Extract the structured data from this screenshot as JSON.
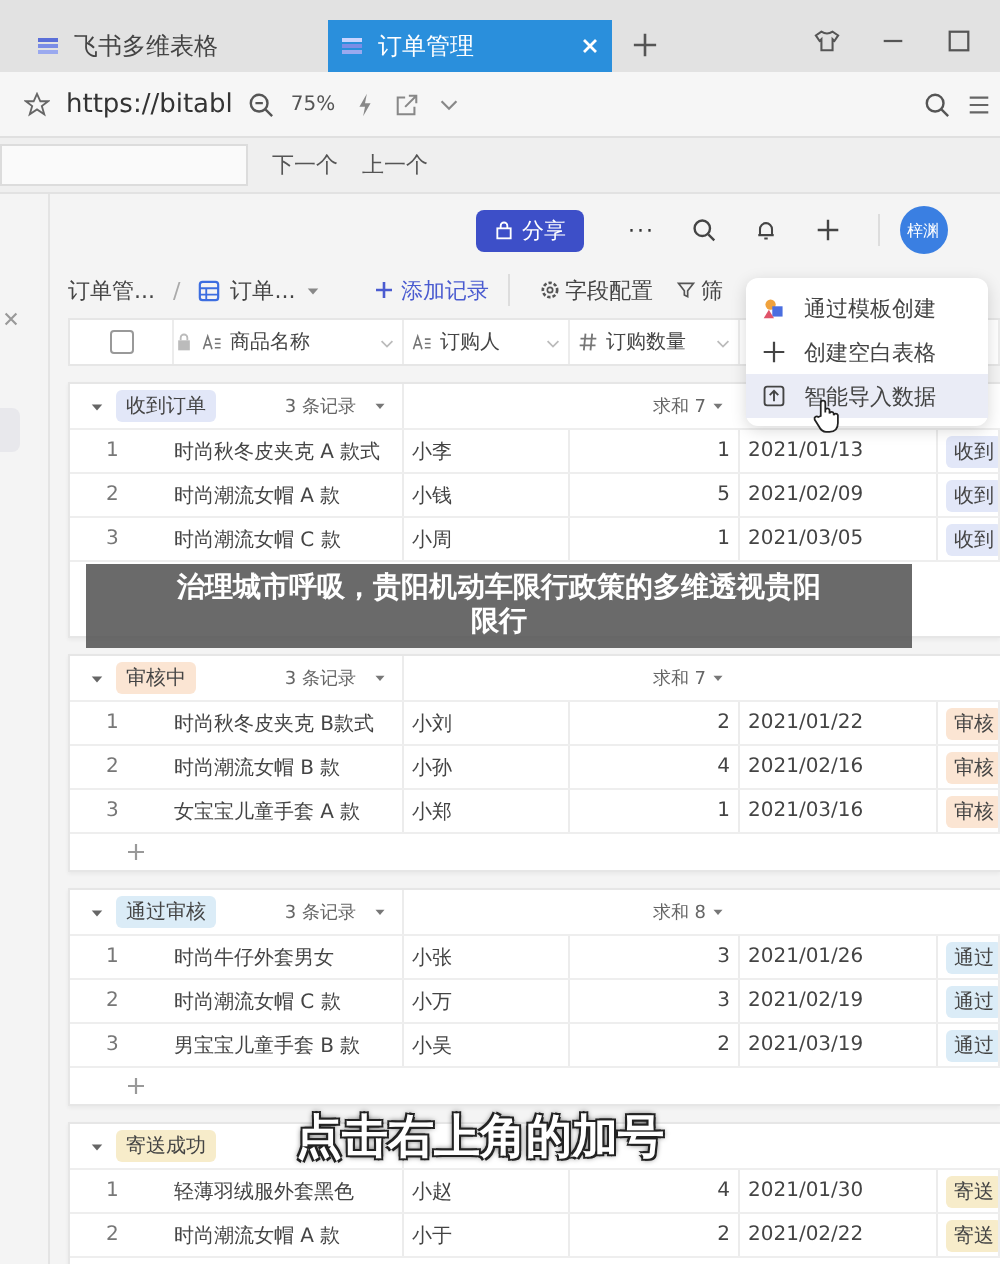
{
  "browser": {
    "tabs": [
      {
        "title": "飞书多维表格",
        "selected": false
      },
      {
        "title": "订单管理",
        "selected": true
      }
    ],
    "url": "https://bitabl",
    "zoom": "75%"
  },
  "find_bar": {
    "next": "下一个",
    "previous": "上一个"
  },
  "header": {
    "share": "分享",
    "more": "···",
    "avatar": "梓渊"
  },
  "toolbar": {
    "breadcrumb": [
      "订单管...",
      "订单..."
    ],
    "separator": "/",
    "add_record": "添加记录",
    "field_config": "字段配置",
    "filter": "筛"
  },
  "menu": [
    {
      "label": "通过模板创建",
      "kind": "template",
      "selected": false
    },
    {
      "label": "创建空白表格",
      "kind": "blank",
      "selected": false
    },
    {
      "label": "智能导入数据",
      "kind": "import",
      "selected": true
    }
  ],
  "table": {
    "select_all_checked": false,
    "columns": [
      {
        "label": "商品名称",
        "kind": "text"
      },
      {
        "label": "订购人",
        "kind": "text"
      },
      {
        "label": "订购数量",
        "kind": "number"
      }
    ],
    "groups": [
      {
        "name": "收到订单",
        "color": "#e2e7f8",
        "count": "3 条记录",
        "sum": "求和 7",
        "rows": [
          {
            "num": "1",
            "name": "时尚秋冬皮夹克 A 款式",
            "buyer": "小李",
            "qty": "1",
            "date": "2021/01/13",
            "status": "收到"
          },
          {
            "num": "2",
            "name": "时尚潮流女帽 A 款",
            "buyer": "小钱",
            "qty": "5",
            "date": "2021/02/09",
            "status": "收到"
          },
          {
            "num": "3",
            "name": "时尚潮流女帽 C 款",
            "buyer": "小周",
            "qty": "1",
            "date": "2021/03/05",
            "status": "收到"
          }
        ]
      },
      {
        "name": "审核中",
        "color": "#fbe5d3",
        "count": "3 条记录",
        "sum": "求和 7",
        "show_add": true,
        "rows": [
          {
            "num": "1",
            "name": "时尚秋冬皮夹克 B款式",
            "buyer": "小刘",
            "qty": "2",
            "date": "2021/01/22",
            "status": "审核"
          },
          {
            "num": "2",
            "name": "时尚潮流女帽 B 款",
            "buyer": "小孙",
            "qty": "4",
            "date": "2021/02/16",
            "status": "审核"
          },
          {
            "num": "3",
            "name": "女宝宝儿童手套 A 款",
            "buyer": "小郑",
            "qty": "1",
            "date": "2021/03/16",
            "status": "审核"
          }
        ]
      },
      {
        "name": "通过审核",
        "color": "#dbecf7",
        "count": "3 条记录",
        "sum": "求和 8",
        "show_add": true,
        "rows": [
          {
            "num": "1",
            "name": "时尚牛仔外套男女",
            "buyer": "小张",
            "qty": "3",
            "date": "2021/01/26",
            "status": "通过"
          },
          {
            "num": "2",
            "name": "时尚潮流女帽 C 款",
            "buyer": "小万",
            "qty": "3",
            "date": "2021/02/19",
            "status": "通过"
          },
          {
            "num": "3",
            "name": "男宝宝儿童手套 B 款",
            "buyer": "小吴",
            "qty": "2",
            "date": "2021/03/19",
            "status": "通过"
          }
        ]
      },
      {
        "name": "寄送成功",
        "color": "#f7ecca",
        "rows": [
          {
            "num": "1",
            "name": "轻薄羽绒服外套黑色",
            "buyer": "小赵",
            "qty": "4",
            "date": "2021/01/30",
            "status": "寄送"
          },
          {
            "num": "2",
            "name": "时尚潮流女帽 A 款",
            "buyer": "小于",
            "qty": "2",
            "date": "2021/02/22",
            "status": "寄送"
          }
        ]
      }
    ]
  },
  "banner": "治理城市呼吸，贵阳机动车限行政策的多维透视贵阳限行",
  "caption": "点击右上角的加号"
}
